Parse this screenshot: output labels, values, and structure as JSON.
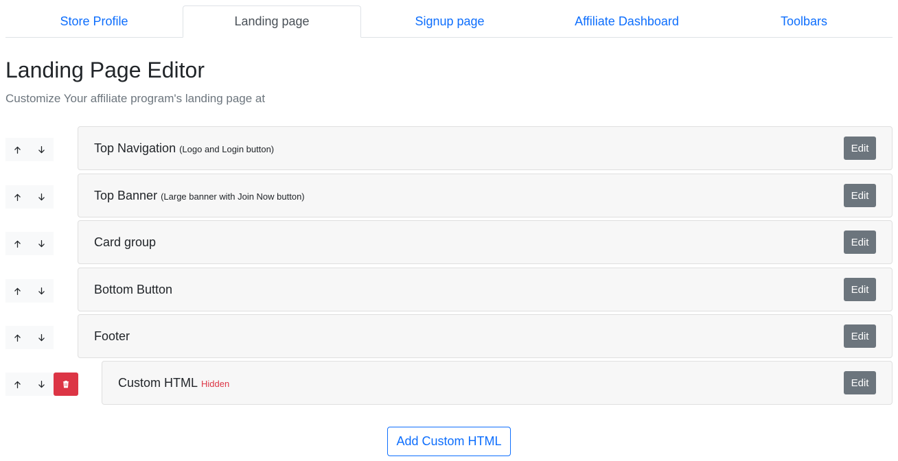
{
  "tabs": [
    {
      "label": "Store Profile",
      "active": false
    },
    {
      "label": "Landing page",
      "active": true
    },
    {
      "label": "Signup page",
      "active": false
    },
    {
      "label": "Affiliate Dashboard",
      "active": false
    },
    {
      "label": "Toolbars",
      "active": false
    }
  ],
  "header": {
    "title": "Landing Page Editor",
    "subtitle": "Customize Your affiliate program's landing page at"
  },
  "sections": [
    {
      "name": "Top Navigation",
      "desc": "(Logo and Login button)",
      "status": "",
      "edit_label": "Edit"
    },
    {
      "name": "Top Banner",
      "desc": "(Large banner with Join Now button)",
      "status": "",
      "edit_label": "Edit"
    },
    {
      "name": "Card group",
      "desc": "",
      "status": "",
      "edit_label": "Edit"
    },
    {
      "name": "Bottom Button",
      "desc": "",
      "status": "",
      "edit_label": "Edit"
    },
    {
      "name": "Footer",
      "desc": "",
      "status": "",
      "edit_label": "Edit"
    },
    {
      "name": "Custom HTML",
      "desc": "",
      "status": "Hidden",
      "edit_label": "Edit"
    }
  ],
  "actions": {
    "add_custom_html_label": "Add Custom HTML"
  },
  "colors": {
    "link": "#0d6efd",
    "edit_button": "#6c757d",
    "danger": "#dc3545"
  },
  "icons": {
    "move_up": "arrow-up-icon",
    "move_down": "arrow-down-icon",
    "delete": "trash-icon"
  }
}
